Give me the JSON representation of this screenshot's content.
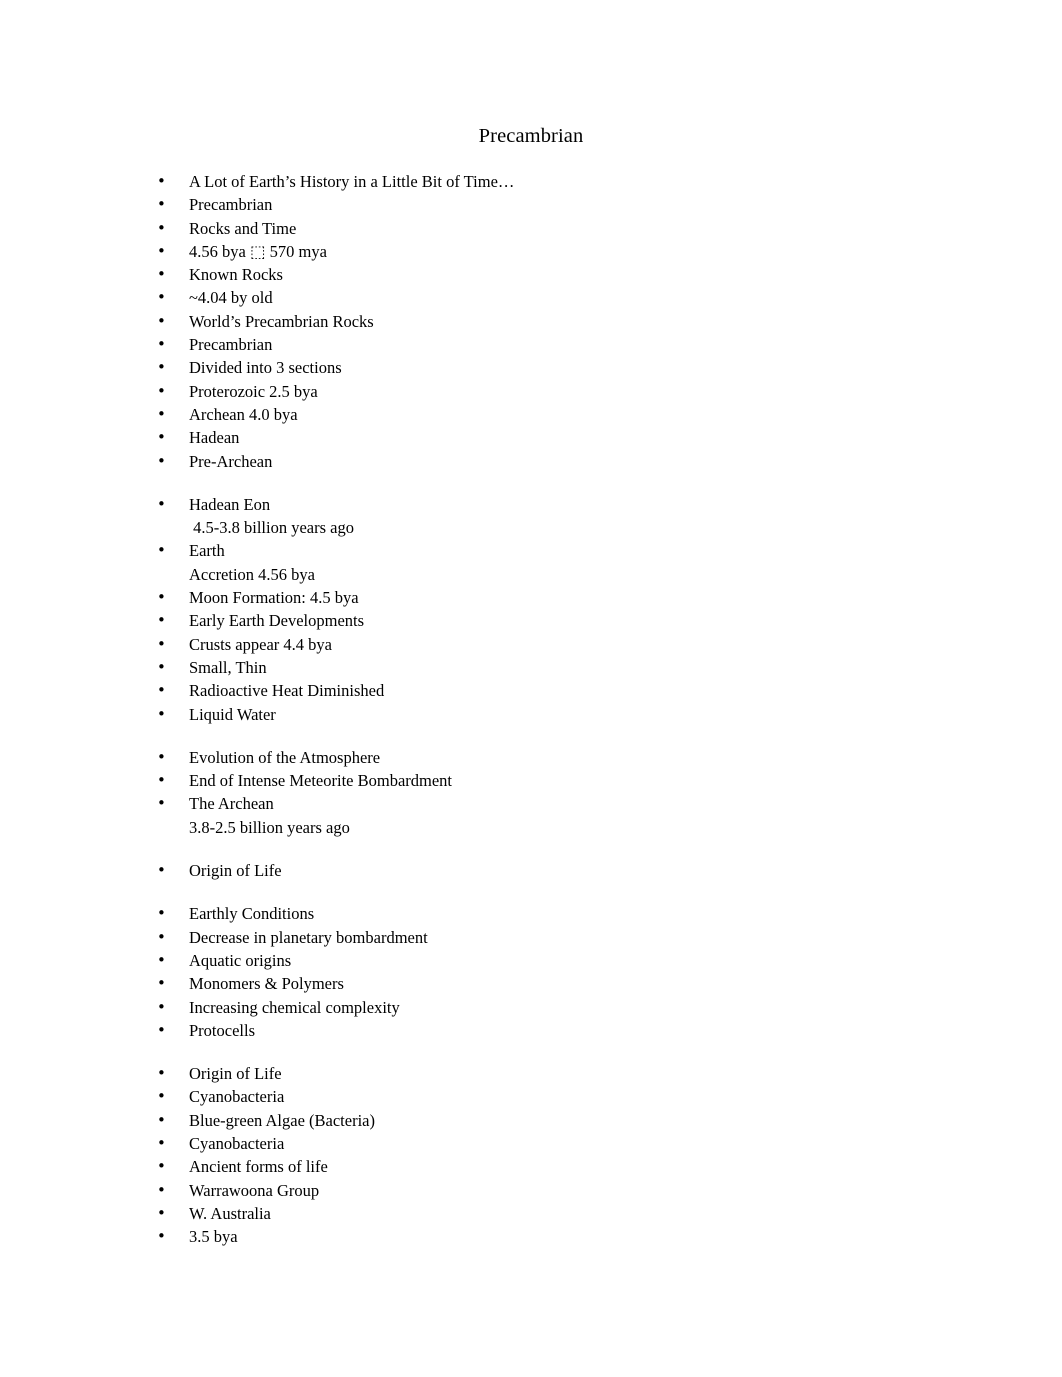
{
  "document": {
    "title": "Precambrian",
    "background_color": "#ffffff",
    "text_color": "#000000"
  },
  "sections": [
    {
      "name": "intro",
      "bullets": [
        {
          "lines": [
            "A Lot of Earth’s History in a Little Bit of Time…"
          ]
        },
        {
          "lines": [
            "Precambrian"
          ]
        },
        {
          "lines": [
            "Rocks and Time"
          ]
        },
        {
          "lines": [
            "4.56 bya ⬚ 570 mya"
          ]
        },
        {
          "lines": [
            "Known Rocks"
          ]
        },
        {
          "lines": [
            "~4.04 by old"
          ]
        },
        {
          "lines": [
            "World’s Precambrian Rocks"
          ]
        },
        {
          "lines": [
            "Precambrian"
          ]
        },
        {
          "lines": [
            "Divided into 3 sections"
          ]
        },
        {
          "lines": [
            "Proterozoic 2.5 bya"
          ]
        },
        {
          "lines": [
            "Archean 4.0 bya"
          ]
        },
        {
          "lines": [
            "Hadean"
          ]
        },
        {
          "lines": [
            "Pre-Archean"
          ]
        }
      ]
    },
    {
      "name": "hadean-eon",
      "bullets": [
        {
          "lines": [
            "Hadean Eon",
            " 4.5-3.8 billion years ago"
          ]
        },
        {
          "lines": [
            "Earth",
            "Accretion 4.56 bya"
          ]
        },
        {
          "lines": [
            "Moon Formation: 4.5 bya"
          ]
        },
        {
          "lines": [
            "Early Earth Developments"
          ]
        },
        {
          "lines": [
            "Crusts appear 4.4 bya"
          ]
        },
        {
          "lines": [
            "Small, Thin"
          ]
        },
        {
          "lines": [
            "Radioactive Heat Diminished"
          ]
        },
        {
          "lines": [
            "Liquid Water"
          ]
        }
      ]
    },
    {
      "name": "archean",
      "bullets": [
        {
          "lines": [
            "Evolution of the Atmosphere"
          ]
        },
        {
          "lines": [
            "End of Intense Meteorite Bombardment"
          ]
        },
        {
          "lines": [
            "The Archean",
            "3.8-2.5 billion years ago"
          ]
        }
      ]
    },
    {
      "name": "origin-of-life-heading",
      "bullets": [
        {
          "lines": [
            "Origin of Life"
          ]
        }
      ]
    },
    {
      "name": "earthly-conditions",
      "bullets": [
        {
          "lines": [
            "Earthly Conditions"
          ]
        },
        {
          "lines": [
            "Decrease in planetary bombardment"
          ]
        },
        {
          "lines": [
            "Aquatic origins"
          ]
        },
        {
          "lines": [
            "Monomers & Polymers"
          ]
        },
        {
          "lines": [
            "Increasing chemical complexity"
          ]
        },
        {
          "lines": [
            "Protocells"
          ]
        }
      ]
    },
    {
      "name": "cyanobacteria",
      "bullets": [
        {
          "lines": [
            "Origin of Life"
          ]
        },
        {
          "lines": [
            "Cyanobacteria"
          ]
        },
        {
          "lines": [
            "Blue-green Algae (Bacteria)"
          ]
        },
        {
          "lines": [
            "Cyanobacteria"
          ]
        },
        {
          "lines": [
            "Ancient forms of life"
          ]
        },
        {
          "lines": [
            "Warrawoona Group"
          ]
        },
        {
          "lines": [
            "W. Australia"
          ]
        },
        {
          "lines": [
            "3.5 bya"
          ]
        }
      ]
    }
  ]
}
